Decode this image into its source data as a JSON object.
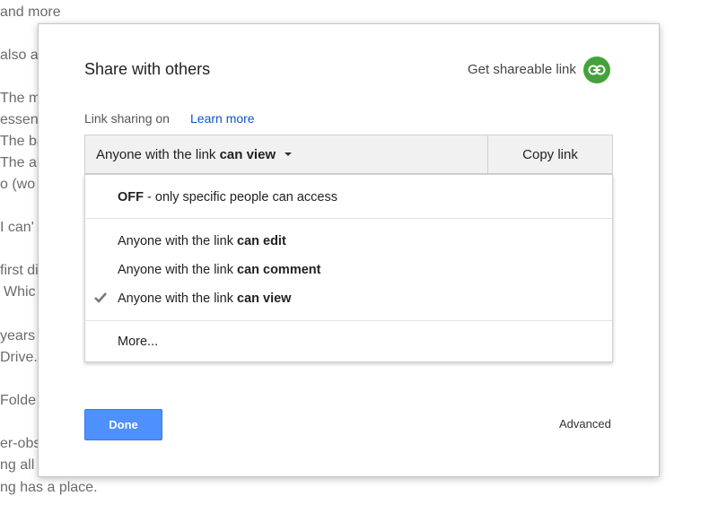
{
  "background_doc": {
    "lines": [
      "and more",
      "also a",
      "The m",
      "essent",
      "The ba",
      "The au",
      "o (wo",
      "I can'",
      "first di",
      "Whic",
      "years",
      "Drive.",
      "Folde",
      "er-obs",
      "ng all",
      "ng has a place."
    ]
  },
  "dialog": {
    "title": "Share with others",
    "get_link_label": "Get shareable link",
    "link_icon": "link-icon",
    "link_icon_color": "#44a23a",
    "link_status": "Link sharing on",
    "learn_more": "Learn more",
    "share_select": {
      "prefix": "Anyone with the link ",
      "bold": "can view"
    },
    "copy_link": "Copy link",
    "menu": {
      "off_bold": "OFF",
      "off_rest": " - only specific people can access",
      "options": [
        {
          "prefix": "Anyone with the link ",
          "bold": "can edit",
          "checked": false
        },
        {
          "prefix": "Anyone with the link ",
          "bold": "can comment",
          "checked": false
        },
        {
          "prefix": "Anyone with the link ",
          "bold": "can view",
          "checked": true
        }
      ],
      "more": "More..."
    },
    "done": "Done",
    "done_color": "#4d90fe",
    "advanced": "Advanced"
  }
}
